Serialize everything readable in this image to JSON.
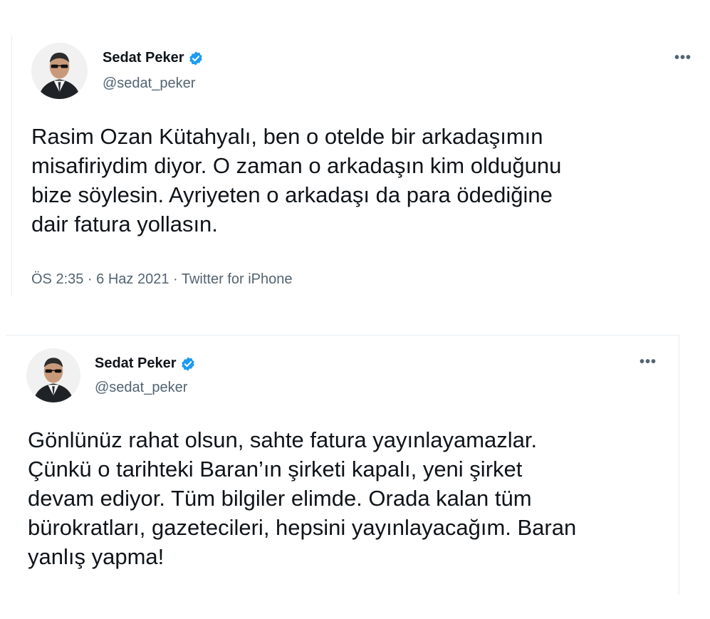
{
  "tweets": [
    {
      "author": {
        "name": "Sedat Peker",
        "handle": "@sedat_peker"
      },
      "more_label": "•••",
      "text": "Rasim Ozan Kütahyalı, ben o otelde bir arkadaşımın\nmisafiriydim diyor. O zaman o arkadaşın kim olduğunu\nbize söylesin. Ayriyeten o arkadaşı da para ödediğine\ndair fatura yollasın.",
      "meta": "ÖS 2:35 · 6 Haz 2021 · Twitter for iPhone"
    },
    {
      "author": {
        "name": "Sedat Peker",
        "handle": "@sedat_peker"
      },
      "more_label": "•••",
      "text": "Gönlünüz rahat olsun, sahte fatura yayınlayamazlar.\nÇünkü o tarihteki Baran’ın şirketi kapalı, yeni şirket\ndevam ediyor. Tüm bilgiler elimde. Orada kalan tüm\nbürokratları, gazetecileri, hepsini yayınlayacağım. Baran\nyanlış yapma!"
    }
  ],
  "colors": {
    "verified": "#1d9bf0",
    "secondary_text": "#536471",
    "primary_text": "#0f1419",
    "border": "#e6ecf0"
  },
  "icons": {
    "verified": "verified-badge-icon",
    "more": "more-options-icon"
  }
}
